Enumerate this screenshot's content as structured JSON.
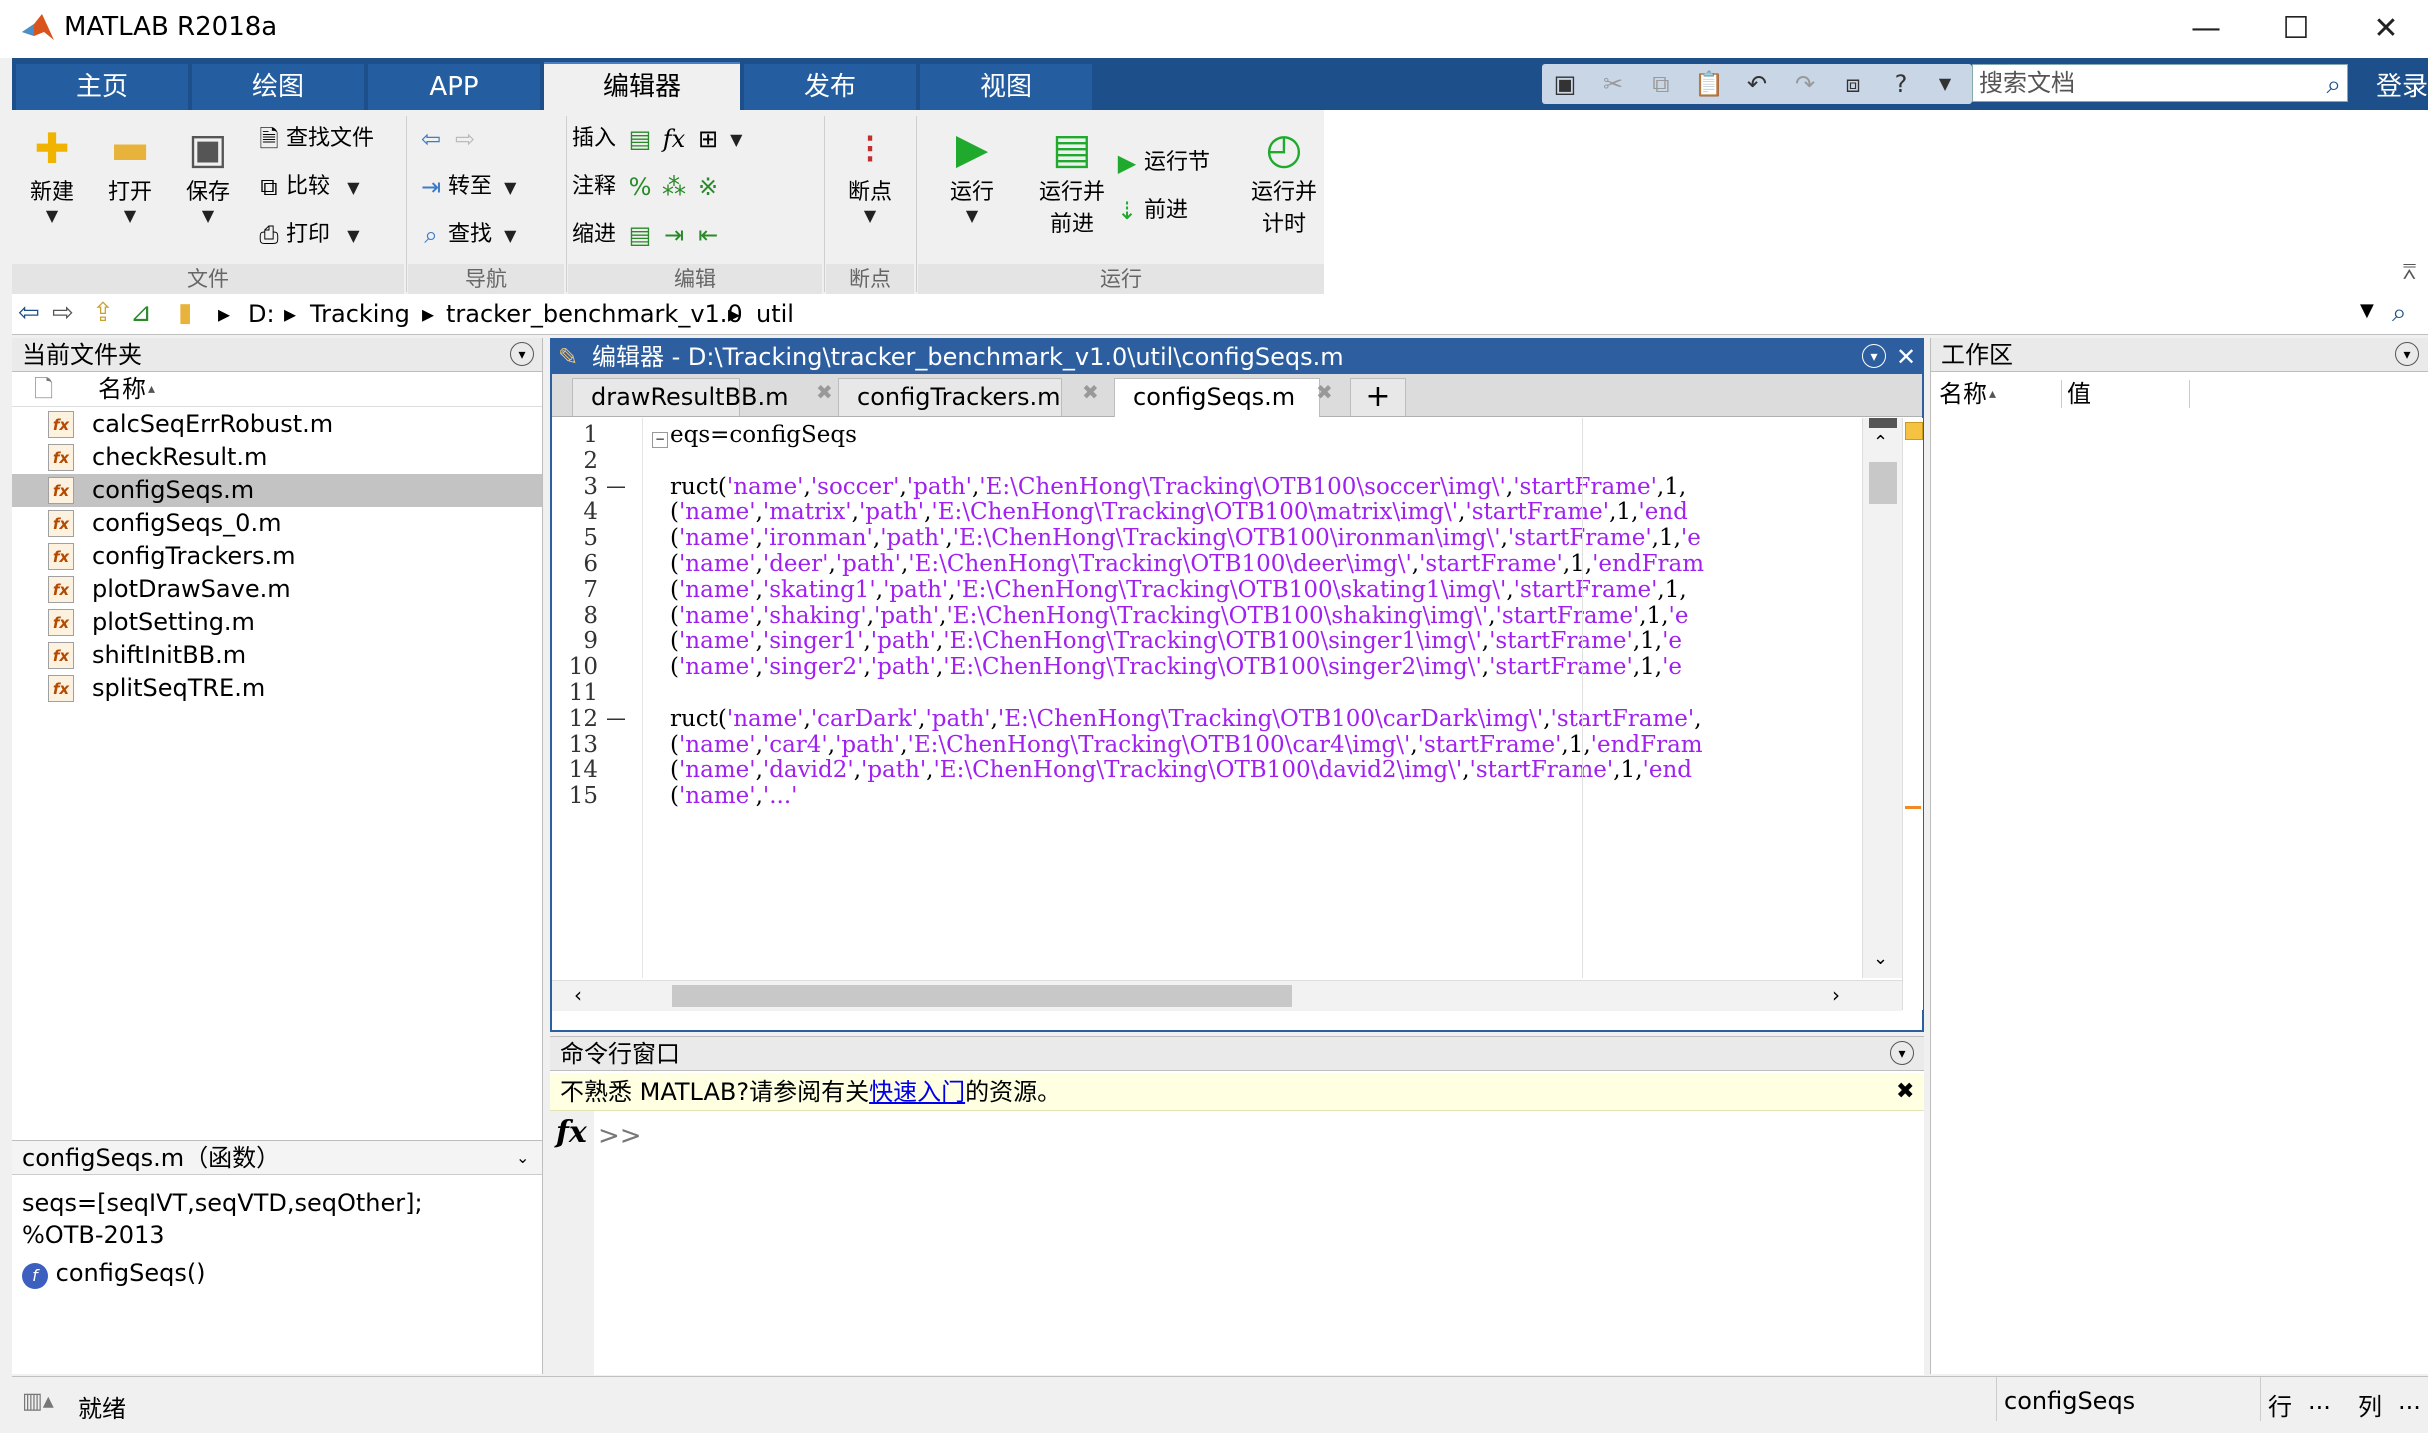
{
  "window": {
    "title": "MATLAB R2018a",
    "minimize": "—",
    "maximize": "☐",
    "close": "✕"
  },
  "ribbon_tabs": [
    "主页",
    "绘图",
    "APP",
    "编辑器",
    "发布",
    "视图"
  ],
  "active_tab_index": 3,
  "search": {
    "placeholder": "搜索文档",
    "login": "登录"
  },
  "ribbon": {
    "file": {
      "new": "新建",
      "open": "打开",
      "save": "保存",
      "find_files": "查找文件",
      "compare": "比较",
      "print": "打印",
      "group": "文件"
    },
    "navigate": {
      "goto": "转至",
      "find": "查找",
      "group": "导航"
    },
    "edit": {
      "insert": "插入",
      "comment": "注释",
      "indent": "缩进",
      "group": "编辑"
    },
    "breakpoints": {
      "label": "断点",
      "group": "断点"
    },
    "run": {
      "run": "运行",
      "run_advance_1": "运行并",
      "run_advance_2": "前进",
      "run_section": "运行节",
      "advance": "前进",
      "run_time_1": "运行并",
      "run_time_2": "计时",
      "group": "运行"
    }
  },
  "address": {
    "crumbs": [
      "D:",
      "Tracking",
      "tracker_benchmark_v1.0",
      "util"
    ]
  },
  "file_panel": {
    "title": "当前文件夹",
    "column": "名称",
    "sort_indicator": "▴",
    "files": [
      "calcSeqErrRobust.m",
      "checkResult.m",
      "configSeqs.m",
      "configSeqs_0.m",
      "configTrackers.m",
      "plotDrawSave.m",
      "plotSetting.m",
      "shiftInitBB.m",
      "splitSeqTRE.m"
    ],
    "selected_index": 2,
    "detail_title": "configSeqs.m（函数）",
    "detail_line1": "seqs=[seqIVT,seqVTD,seqOther];",
    "detail_line2": "%OTB-2013",
    "detail_func": "configSeqs()"
  },
  "editor": {
    "header": "编辑器 - D:\\Tracking\\tracker_benchmark_v1.0\\util\\configSeqs.m",
    "tabs": [
      "drawResultBB.m",
      "configTrackers.m",
      "configSeqs.m"
    ],
    "active_tab": 2,
    "new_tab": "+",
    "tab_close": "✖",
    "line_numbers": [
      "1",
      "2",
      "3",
      "4",
      "5",
      "6",
      "7",
      "8",
      "9",
      "10",
      "11",
      "12",
      "13",
      "14",
      "15"
    ],
    "breakpoint_dashes": [
      "—",
      "—"
    ],
    "lines": [
      [
        {
          "t": "eqs=configSeqs",
          "c": "k"
        }
      ],
      [],
      [
        {
          "t": "ruct(",
          "c": "k"
        },
        {
          "t": "'name'",
          "c": "s"
        },
        {
          "t": ",",
          "c": "k"
        },
        {
          "t": "'soccer'",
          "c": "s"
        },
        {
          "t": ",",
          "c": "k"
        },
        {
          "t": "'path'",
          "c": "s"
        },
        {
          "t": ",",
          "c": "k"
        },
        {
          "t": "'E:\\ChenHong\\Tracking\\OTB100\\soccer\\img\\'",
          "c": "s"
        },
        {
          "t": ",",
          "c": "k"
        },
        {
          "t": "'startFrame'",
          "c": "s"
        },
        {
          "t": ",1,",
          "c": "k"
        }
      ],
      [
        {
          "t": "(",
          "c": "k"
        },
        {
          "t": "'name'",
          "c": "s"
        },
        {
          "t": ",",
          "c": "k"
        },
        {
          "t": "'matrix'",
          "c": "s"
        },
        {
          "t": ",",
          "c": "k"
        },
        {
          "t": "'path'",
          "c": "s"
        },
        {
          "t": ",",
          "c": "k"
        },
        {
          "t": "'E:\\ChenHong\\Tracking\\OTB100\\matrix\\img\\'",
          "c": "s"
        },
        {
          "t": ",",
          "c": "k"
        },
        {
          "t": "'startFrame'",
          "c": "s"
        },
        {
          "t": ",1,",
          "c": "k"
        },
        {
          "t": "'end",
          "c": "s"
        }
      ],
      [
        {
          "t": "(",
          "c": "k"
        },
        {
          "t": "'name'",
          "c": "s"
        },
        {
          "t": ",",
          "c": "k"
        },
        {
          "t": "'ironman'",
          "c": "s"
        },
        {
          "t": ",",
          "c": "k"
        },
        {
          "t": "'path'",
          "c": "s"
        },
        {
          "t": ",",
          "c": "k"
        },
        {
          "t": "'E:\\ChenHong\\Tracking\\OTB100\\ironman\\img\\'",
          "c": "s"
        },
        {
          "t": ",",
          "c": "k"
        },
        {
          "t": "'startFrame'",
          "c": "s"
        },
        {
          "t": ",1,",
          "c": "k"
        },
        {
          "t": "'e",
          "c": "s"
        }
      ],
      [
        {
          "t": "(",
          "c": "k"
        },
        {
          "t": "'name'",
          "c": "s"
        },
        {
          "t": ",",
          "c": "k"
        },
        {
          "t": "'deer'",
          "c": "s"
        },
        {
          "t": ",",
          "c": "k"
        },
        {
          "t": "'path'",
          "c": "s"
        },
        {
          "t": ",",
          "c": "k"
        },
        {
          "t": "'E:\\ChenHong\\Tracking\\OTB100\\deer\\img\\'",
          "c": "s"
        },
        {
          "t": ",",
          "c": "k"
        },
        {
          "t": "'startFrame'",
          "c": "s"
        },
        {
          "t": ",1,",
          "c": "k"
        },
        {
          "t": "'endFram",
          "c": "s"
        }
      ],
      [
        {
          "t": "(",
          "c": "k"
        },
        {
          "t": "'name'",
          "c": "s"
        },
        {
          "t": ",",
          "c": "k"
        },
        {
          "t": "'skating1'",
          "c": "s"
        },
        {
          "t": ",",
          "c": "k"
        },
        {
          "t": "'path'",
          "c": "s"
        },
        {
          "t": ",",
          "c": "k"
        },
        {
          "t": "'E:\\ChenHong\\Tracking\\OTB100\\skating1\\img\\'",
          "c": "s"
        },
        {
          "t": ",",
          "c": "k"
        },
        {
          "t": "'startFrame'",
          "c": "s"
        },
        {
          "t": ",1,",
          "c": "k"
        }
      ],
      [
        {
          "t": "(",
          "c": "k"
        },
        {
          "t": "'name'",
          "c": "s"
        },
        {
          "t": ",",
          "c": "k"
        },
        {
          "t": "'shaking'",
          "c": "s"
        },
        {
          "t": ",",
          "c": "k"
        },
        {
          "t": "'path'",
          "c": "s"
        },
        {
          "t": ",",
          "c": "k"
        },
        {
          "t": "'E:\\ChenHong\\Tracking\\OTB100\\shaking\\img\\'",
          "c": "s"
        },
        {
          "t": ",",
          "c": "k"
        },
        {
          "t": "'startFrame'",
          "c": "s"
        },
        {
          "t": ",1,",
          "c": "k"
        },
        {
          "t": "'e",
          "c": "s"
        }
      ],
      [
        {
          "t": "(",
          "c": "k"
        },
        {
          "t": "'name'",
          "c": "s"
        },
        {
          "t": ",",
          "c": "k"
        },
        {
          "t": "'singer1'",
          "c": "s"
        },
        {
          "t": ",",
          "c": "k"
        },
        {
          "t": "'path'",
          "c": "s"
        },
        {
          "t": ",",
          "c": "k"
        },
        {
          "t": "'E:\\ChenHong\\Tracking\\OTB100\\singer1\\img\\'",
          "c": "s"
        },
        {
          "t": ",",
          "c": "k"
        },
        {
          "t": "'startFrame'",
          "c": "s"
        },
        {
          "t": ",1,",
          "c": "k"
        },
        {
          "t": "'e",
          "c": "s"
        }
      ],
      [
        {
          "t": "(",
          "c": "k"
        },
        {
          "t": "'name'",
          "c": "s"
        },
        {
          "t": ",",
          "c": "k"
        },
        {
          "t": "'singer2'",
          "c": "s"
        },
        {
          "t": ",",
          "c": "k"
        },
        {
          "t": "'path'",
          "c": "s"
        },
        {
          "t": ",",
          "c": "k"
        },
        {
          "t": "'E:\\ChenHong\\Tracking\\OTB100\\singer2\\img\\'",
          "c": "s"
        },
        {
          "t": ",",
          "c": "k"
        },
        {
          "t": "'startFrame'",
          "c": "s"
        },
        {
          "t": ",1,",
          "c": "k"
        },
        {
          "t": "'e",
          "c": "s"
        }
      ],
      [],
      [
        {
          "t": "ruct(",
          "c": "k"
        },
        {
          "t": "'name'",
          "c": "s"
        },
        {
          "t": ",",
          "c": "k"
        },
        {
          "t": "'carDark'",
          "c": "s"
        },
        {
          "t": ",",
          "c": "k"
        },
        {
          "t": "'path'",
          "c": "s"
        },
        {
          "t": ",",
          "c": "k"
        },
        {
          "t": "'E:\\ChenHong\\Tracking\\OTB100\\carDark\\img\\'",
          "c": "s"
        },
        {
          "t": ",",
          "c": "k"
        },
        {
          "t": "'startFrame'",
          "c": "s"
        },
        {
          "t": ",",
          "c": "k"
        }
      ],
      [
        {
          "t": "(",
          "c": "k"
        },
        {
          "t": "'name'",
          "c": "s"
        },
        {
          "t": ",",
          "c": "k"
        },
        {
          "t": "'car4'",
          "c": "s"
        },
        {
          "t": ",",
          "c": "k"
        },
        {
          "t": "'path'",
          "c": "s"
        },
        {
          "t": ",",
          "c": "k"
        },
        {
          "t": "'E:\\ChenHong\\Tracking\\OTB100\\car4\\img\\'",
          "c": "s"
        },
        {
          "t": ",",
          "c": "k"
        },
        {
          "t": "'startFrame'",
          "c": "s"
        },
        {
          "t": ",1,",
          "c": "k"
        },
        {
          "t": "'endFram",
          "c": "s"
        }
      ],
      [
        {
          "t": "(",
          "c": "k"
        },
        {
          "t": "'name'",
          "c": "s"
        },
        {
          "t": ",",
          "c": "k"
        },
        {
          "t": "'david2'",
          "c": "s"
        },
        {
          "t": ",",
          "c": "k"
        },
        {
          "t": "'path'",
          "c": "s"
        },
        {
          "t": ",",
          "c": "k"
        },
        {
          "t": "'E:\\ChenHong\\Tracking\\OTB100\\david2\\img\\'",
          "c": "s"
        },
        {
          "t": ",",
          "c": "k"
        },
        {
          "t": "'startFrame'",
          "c": "s"
        },
        {
          "t": ",1,",
          "c": "k"
        },
        {
          "t": "'end",
          "c": "s"
        }
      ],
      [
        {
          "t": "(",
          "c": "k"
        },
        {
          "t": "'name'",
          "c": "s"
        },
        {
          "t": ",",
          "c": "k"
        },
        {
          "t": "'...'",
          "c": "s"
        }
      ]
    ]
  },
  "command_window": {
    "title": "命令行窗口",
    "notice_prefix": "不熟悉 MATLAB?请参阅有关",
    "notice_link": "快速入门",
    "notice_suffix": "的资源。",
    "notice_close": "✖",
    "fx": "fx",
    "prompt": ">>"
  },
  "workspace": {
    "title": "工作区",
    "col_name": "名称",
    "sort_indicator": "▴",
    "col_value": "值"
  },
  "status": {
    "text": "就绪",
    "function": "configSeqs",
    "row": "行",
    "ellipsis": "...",
    "col": "列"
  },
  "colors": {
    "ribbon_blue": "#1d4f8a",
    "string_purple": "#a020f0",
    "editor_border": "#2d5fa0"
  }
}
